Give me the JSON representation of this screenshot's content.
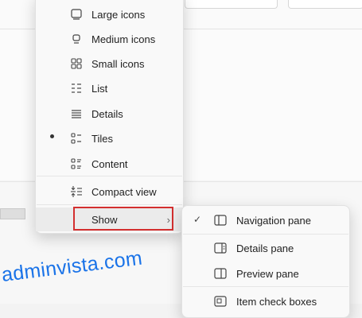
{
  "menu": {
    "items": [
      {
        "label": "Large icons",
        "icon": "large-icons-icon",
        "selected": false
      },
      {
        "label": "Medium icons",
        "icon": "medium-icons-icon",
        "selected": false
      },
      {
        "label": "Small icons",
        "icon": "small-icons-icon",
        "selected": false
      },
      {
        "label": "List",
        "icon": "list-icon",
        "selected": false
      },
      {
        "label": "Details",
        "icon": "details-icon",
        "selected": false
      },
      {
        "label": "Tiles",
        "icon": "tiles-icon",
        "selected": true
      },
      {
        "label": "Content",
        "icon": "content-icon",
        "selected": false
      },
      {
        "label": "Compact view",
        "icon": "compact-view-icon",
        "selected": false
      }
    ],
    "show_label": "Show"
  },
  "submenu": {
    "items": [
      {
        "label": "Navigation pane",
        "checked": true,
        "icon": "navigation-pane-icon"
      },
      {
        "label": "Details pane",
        "checked": false,
        "icon": "details-pane-icon"
      },
      {
        "label": "Preview pane",
        "checked": false,
        "icon": "preview-pane-icon"
      },
      {
        "label": "Item check boxes",
        "checked": false,
        "icon": "item-check-boxes-icon"
      }
    ]
  },
  "watermark": "adminvista.com",
  "colors": {
    "highlight": "#d32f2f",
    "watermark": "#1a73e8"
  }
}
